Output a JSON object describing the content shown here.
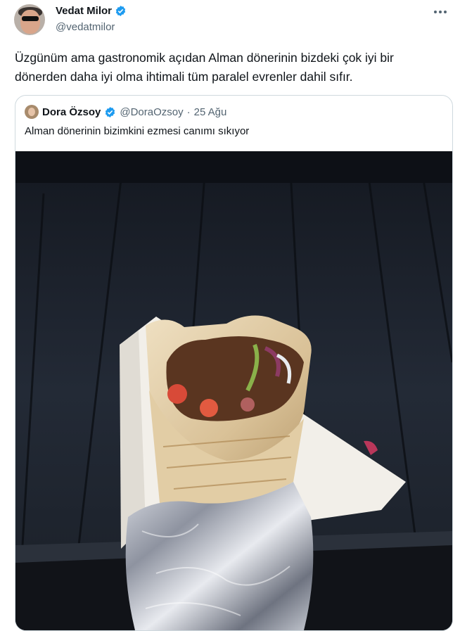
{
  "author": {
    "display_name": "Vedat Milor",
    "handle": "@vedatmilor",
    "verified": true
  },
  "tweet": {
    "text": "Üzgünüm ama gastronomik açıdan Alman dönerinin bizdeki çok iyi bir dönerden daha iyi olma ihtimali tüm paralel evrenler dahil sıfır."
  },
  "quoted": {
    "display_name": "Dora Özsoy",
    "handle": "@DoraOzsoy",
    "separator": "·",
    "date": "25 Ağu",
    "text": "Alman dönerinin bizimkini ezmesi canımı sıkıyor",
    "verified": true
  },
  "colors": {
    "verified_blue": "#1d9bf0",
    "secondary_text": "#536471",
    "border": "#cfd9de"
  },
  "icons": {
    "verified": "verified-badge-icon",
    "more": "more-horizontal-icon"
  }
}
